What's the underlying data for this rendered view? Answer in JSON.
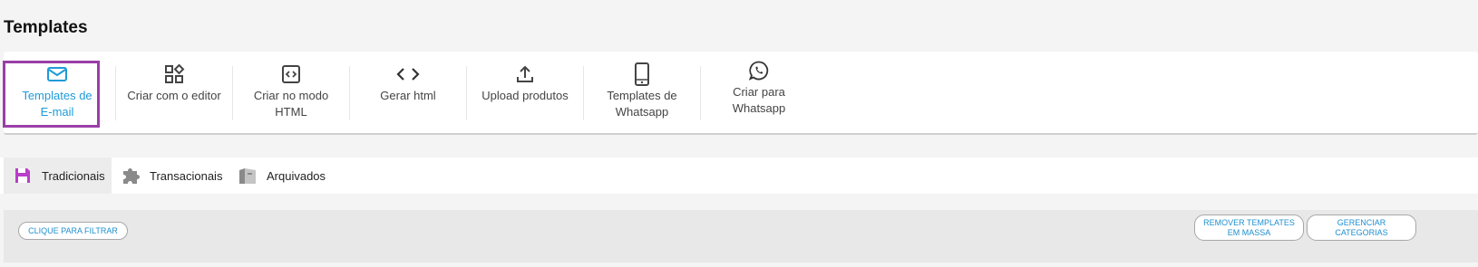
{
  "page": {
    "title": "Templates"
  },
  "toolbar": {
    "items": [
      {
        "label_line1": "Templates de",
        "label_line2": "E-mail",
        "icon": "mail-icon",
        "active": true
      },
      {
        "label_line1": "Criar com o editor",
        "label_line2": "",
        "icon": "blocks-icon"
      },
      {
        "label_line1": "Criar no modo",
        "label_line2": "HTML",
        "icon": "code-box-icon"
      },
      {
        "label_line1": "Gerar html",
        "label_line2": "",
        "icon": "code-brackets-icon"
      },
      {
        "label_line1": "Upload produtos",
        "label_line2": "",
        "icon": "upload-icon"
      },
      {
        "label_line1": "Templates de",
        "label_line2": "Whatsapp",
        "icon": "phone-icon"
      },
      {
        "label_line1": "Criar para",
        "label_line2": "Whatsapp",
        "icon": "whatsapp-icon"
      }
    ],
    "active_color": "#1e9bd7",
    "highlight_color": "#9b3ea8"
  },
  "tabs": [
    {
      "label": "Tradicionais",
      "icon": "floppy-disk-icon",
      "color": "#b83fc8",
      "selected": true
    },
    {
      "label": "Transacionais",
      "icon": "puzzle-icon",
      "color": "#8a8a8a"
    },
    {
      "label": "Arquivados",
      "icon": "archive-icon",
      "color": "#8a8a8a"
    }
  ],
  "filters": {
    "filter_button": "CLIQUE PARA FILTRAR",
    "remove_mass_line1": "REMOVER TEMPLATES",
    "remove_mass_line2": "EM MASSA",
    "manage_categories_line1": "GERENCIAR",
    "manage_categories_line2": "CATEGORIAS"
  }
}
